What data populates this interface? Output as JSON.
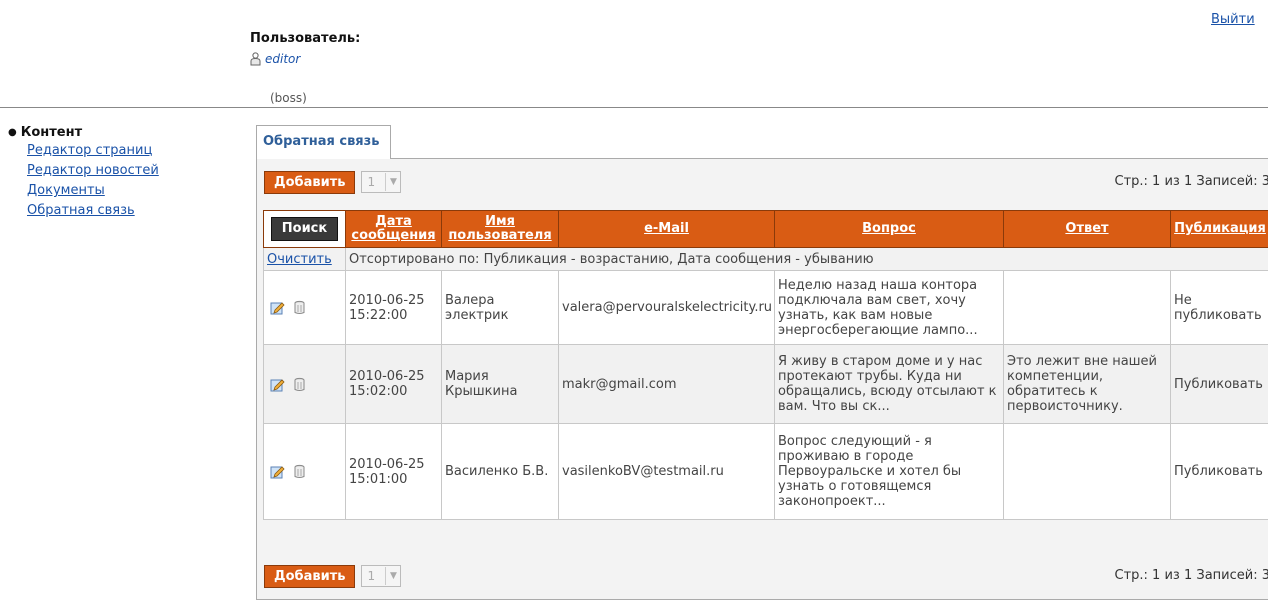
{
  "header": {
    "logout_label": "Выйти",
    "user_label": "Пользователь:",
    "user_name": "editor",
    "user_role": "(boss)"
  },
  "sidebar": {
    "section_title": "Контент",
    "items": [
      {
        "label": "Редактор страниц"
      },
      {
        "label": "Редактор новостей"
      },
      {
        "label": "Документы"
      },
      {
        "label": "Обратная связь"
      }
    ]
  },
  "tab": {
    "label": "Обратная связь"
  },
  "toolbar": {
    "add_label": "Добавить",
    "page_value": "1",
    "pager_info": "Стр.: 1 из 1  Записей: 3"
  },
  "grid": {
    "search_label": "Поиск",
    "columns": {
      "date_l1": "Дата",
      "date_l2": "сообщения",
      "user_l1": "Имя",
      "user_l2": "пользователя",
      "email": "e-Mail",
      "question": "Вопрос",
      "answer": "Ответ",
      "publication": "Публикация"
    },
    "clear_label": "Очистить",
    "sort_info": "Отсортировано по: Публикация - возрастанию, Дата сообщения - убыванию",
    "rows": [
      {
        "date": "2010-06-25 15:22:00",
        "user": "Валера электрик",
        "email": "valera@pervouralskelectricity.ru",
        "question": "Неделю назад наша контора подключала вам свет, хочу узнать, как вам новые энергосберегающие лампо...",
        "answer": "",
        "publication": "Не публиковать"
      },
      {
        "date": "2010-06-25 15:02:00",
        "user": "Мария Крышкина",
        "email": "makr@gmail.com",
        "question": "Я живу в старом доме и у нас протекают трубы. Куда ни обращались, всюду отсылают к вам. Что вы ск...",
        "answer": "Это лежит вне нашей компетенции, обратитесь к первоисточнику.",
        "publication": "Публиковать"
      },
      {
        "date": "2010-06-25 15:01:00",
        "user": "Василенко Б.В.",
        "email": "vasilenkoBV@testmail.ru",
        "question": "Вопрос следующий - я проживаю в городе Первоуральске и хотел бы узнать о готовящемся законопроект...",
        "answer": "",
        "publication": "Публиковать"
      }
    ]
  },
  "colors": {
    "accent": "#d95c14",
    "link": "#1a52a8"
  }
}
